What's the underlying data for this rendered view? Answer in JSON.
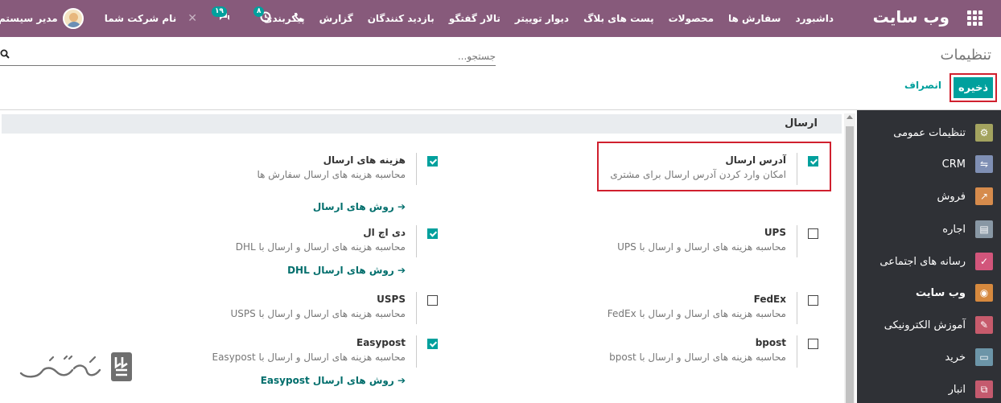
{
  "navbar": {
    "brand": "وب سایت",
    "menu": [
      "داشبورد",
      "سفارش ها",
      "محصولات",
      "پست های بلاگ",
      "دیوار توییتر",
      "تالار گفتگو",
      "بازدید کنندگان",
      "گزارش",
      "پیکربندی"
    ],
    "activity_count": "۸",
    "messages_count": "۱۹",
    "company": "نام شرکت شما",
    "user": "مدیر سیستم"
  },
  "control_panel": {
    "title": "تنظیمات",
    "search_placeholder": "جستجو...",
    "save_label": "ذخیره",
    "discard_label": "انصراف"
  },
  "sidebar": {
    "items": [
      {
        "label": "تنظیمات عمومی",
        "icon": "gear-icon",
        "color": "#a3a35f",
        "glyph": "⚙"
      },
      {
        "label": "CRM",
        "icon": "handshake-icon",
        "color": "#7f8fb4",
        "glyph": "⇋"
      },
      {
        "label": "فروش",
        "icon": "chart-icon",
        "color": "#d68b4c",
        "glyph": "↗"
      },
      {
        "label": "اجاره",
        "icon": "calendar-icon",
        "color": "#8897a4",
        "glyph": "▤"
      },
      {
        "label": "رسانه های اجتماعی",
        "icon": "thumbs-up-icon",
        "color": "#d2557b",
        "glyph": "👍"
      },
      {
        "label": "وب سایت",
        "icon": "globe-icon",
        "color": "#d6893e",
        "glyph": "◉"
      },
      {
        "label": "آموزش الکترونیکی",
        "icon": "elearning-icon",
        "color": "#c75b6c",
        "glyph": "✎"
      },
      {
        "label": "خرید",
        "icon": "credit-card-icon",
        "color": "#6c95a8",
        "glyph": "▭"
      },
      {
        "label": "انبار",
        "icon": "box-icon",
        "color": "#c45a6e",
        "glyph": "⧉"
      }
    ],
    "active_label": "وب سایت"
  },
  "section": {
    "title": "ارسال",
    "settings": [
      {
        "key": "ship_address",
        "title": "آدرس ارسال",
        "desc": "امکان وارد کردن آدرس ارسال برای مشتری",
        "checked": true,
        "link": ""
      },
      {
        "key": "ship_cost",
        "title": "هزینه های ارسال",
        "desc": "محاسبه هزینه های ارسال سفارش ها",
        "checked": true,
        "link": "روش های ارسال"
      },
      {
        "key": "ups",
        "title": "UPS",
        "desc": "محاسبه هزینه های ارسال و ارسال با UPS",
        "checked": false,
        "link": ""
      },
      {
        "key": "dhl",
        "title": "دی اچ ال",
        "desc": "محاسبه هزینه های ارسال و ارسال با DHL",
        "checked": true,
        "link": "روش های ارسال DHL"
      },
      {
        "key": "fedex",
        "title": "FedEx",
        "desc": "محاسبه هزینه های ارسال و ارسال با FedEx",
        "checked": false,
        "link": ""
      },
      {
        "key": "usps",
        "title": "USPS",
        "desc": "محاسبه هزینه های ارسال و ارسال با USPS",
        "checked": false,
        "link": ""
      },
      {
        "key": "bpost",
        "title": "bpost",
        "desc": "محاسبه هزینه های ارسال و ارسال با bpost",
        "checked": false,
        "link": ""
      },
      {
        "key": "easypost",
        "title": "Easypost",
        "desc": "محاسبه هزینه های ارسال و ارسال با Easypost",
        "checked": true,
        "link": "روش های ارسال Easypost"
      }
    ]
  },
  "watermark": {
    "logo": "تسهیلگستر"
  }
}
